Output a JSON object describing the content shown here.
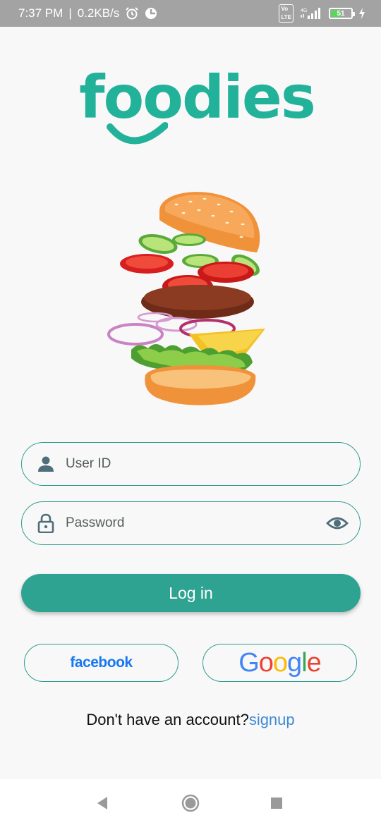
{
  "status_bar": {
    "time": "7:37 PM",
    "speed": "0.2KB/s",
    "network": "4G",
    "battery": "51",
    "battery_level": 0.51
  },
  "logo": {
    "text": "foodies",
    "color": "#22b29a"
  },
  "login_form": {
    "user_id_placeholder": "User ID",
    "password_placeholder": "Password",
    "login_button": "Log in",
    "accent_color": "#2fa391"
  },
  "social": {
    "facebook_label": "facebook",
    "google_letters": [
      "G",
      "o",
      "o",
      "g",
      "l",
      "e"
    ],
    "google_colors": [
      "#4285F4",
      "#EA4335",
      "#FBBC05",
      "#4285F4",
      "#34A853",
      "#EA4335"
    ]
  },
  "signup": {
    "prompt": "Don't have an account?",
    "link": "signup"
  },
  "nav": {
    "buttons": [
      "back-icon",
      "home-icon",
      "recents-icon"
    ]
  }
}
